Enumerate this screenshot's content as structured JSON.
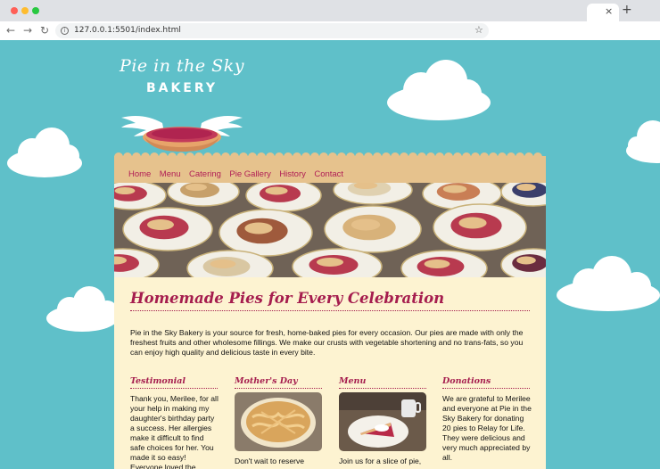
{
  "browser": {
    "url": "127.0.0.1:5501/index.html",
    "tab_close": "×",
    "new_tab": "+",
    "back": "←",
    "forward": "→",
    "reload": "↻",
    "info": "i",
    "star": "☆"
  },
  "logo": {
    "title": "Pie in the Sky",
    "subtitle": "BAKERY"
  },
  "nav": {
    "items": [
      "Home",
      "Menu",
      "Catering",
      "Pie Gallery",
      "History",
      "Contact"
    ]
  },
  "main": {
    "headline": "Homemade Pies for Every Celebration",
    "intro": "Pie in the Sky Bakery is your source for fresh, home-baked pies for every occasion. Our pies are made with only the freshest fruits and other wholesome fillings. We make our crusts with vegetable shortening and no trans-fats, so you can enjoy high quality and delicious taste in every bite."
  },
  "columns": {
    "testimonial": {
      "heading": "Testimonial",
      "text": "Thank you, Merilee, for all your help in making my daughter's birthday party a success. Her allergies make it difficult to find safe choices for her. You made it so easy! Everyone loved the"
    },
    "mothers_day": {
      "heading": "Mother's Day",
      "text": "Don't wait to reserve"
    },
    "menu": {
      "heading": "Menu",
      "text": "Join us for a slice of pie,"
    },
    "donations": {
      "heading": "Donations",
      "text": "We are grateful to Merilee and everyone at Pie in the Sky Bakery for donating 20 pies to Relay for Life. They were delicious and very much appreciated by all."
    }
  },
  "colors": {
    "sky": "#5fc0c9",
    "nav": "#e6c28d",
    "content_bg": "#fdf3d1",
    "accent": "#a51d4e"
  }
}
